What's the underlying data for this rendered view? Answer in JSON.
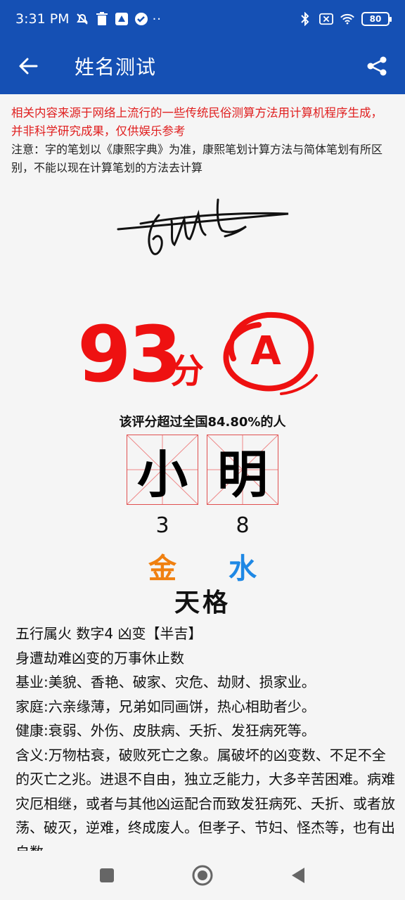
{
  "status_bar": {
    "time": "3:31 PM",
    "battery": "80",
    "dots": "··"
  },
  "app_bar": {
    "title": "姓名测试"
  },
  "notices": {
    "disclaimer": "相关内容来源于网络上流行的一些传统民俗测算方法用计算机程序生成，并非科学研究成果，仅供娱乐参考",
    "note": "注意：字的笔划以《康熙字典》为准，康熙笔划计算方法与简体笔划有所区别，不能以现在计算笔划的方法去计算"
  },
  "score": {
    "value": "93",
    "unit": "分",
    "grade": "A",
    "exceed_text": "该评分超过全国84.80%的人"
  },
  "name_chars": [
    {
      "char": "小",
      "strokes": "3",
      "element": "金",
      "element_color": "#f08010"
    },
    {
      "char": "明",
      "strokes": "8",
      "element": "水",
      "element_color": "#1e88e5"
    }
  ],
  "section": {
    "title": "天格"
  },
  "description": [
    "五行属火 数字4 凶变【半吉】",
    "身遭劫难凶变的万事休止数",
    "基业:美貌、香艳、破家、灾危、劫财、损家业。",
    "家庭:六亲缘薄，兄弟如同画饼，热心相助者少。",
    "健康:衰弱、外伤、皮肤病、夭折、发狂病死等。",
    "含义:万物枯衰，破败死亡之象。属破坏的凶变数、不足不全的灭亡之兆。进退不自由，独立乏能力，大多辛苦困难。病难灾厄相继，或者与其他凶运配合而致发狂病死、夭折、或者放荡、破灭，逆难，终成废人。但孝子、节妇、怪杰等，也有出自数"
  ],
  "colors": {
    "primary": "#1550b4",
    "score_red": "#ee1111",
    "notice_red": "#e02020"
  }
}
